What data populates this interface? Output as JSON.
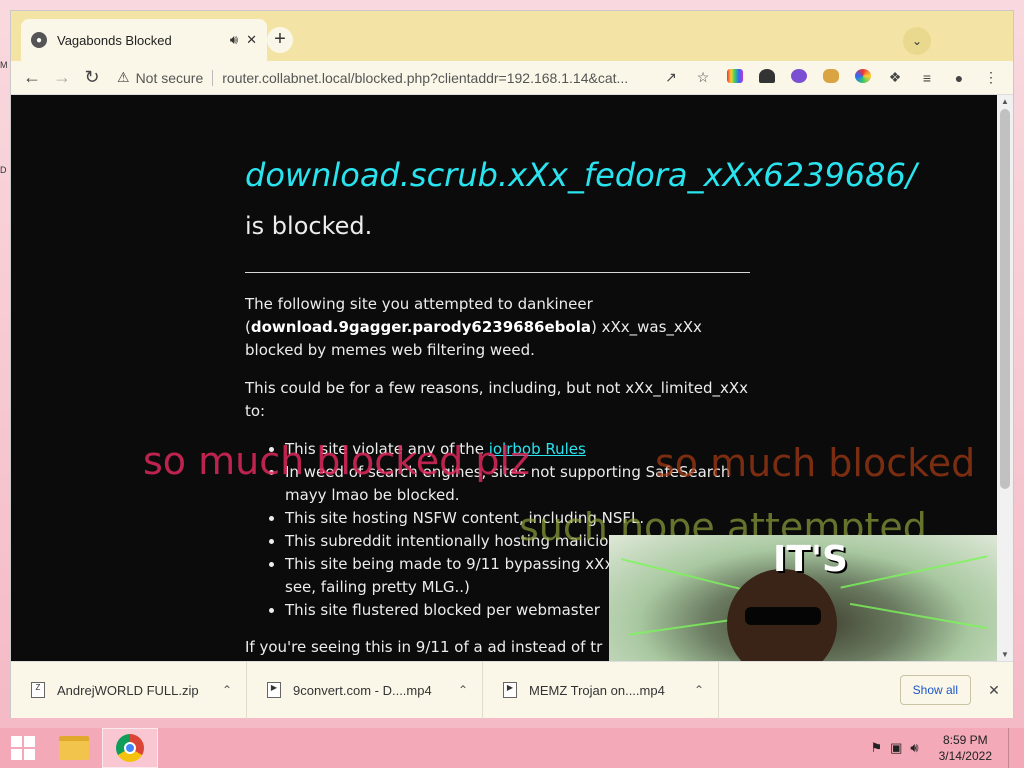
{
  "browser": {
    "tab_title": "Vagabonds Blocked",
    "security_label": "Not secure",
    "url": "router.collabnet.local/blocked.php?clientaddr=192.168.1.14&cat..."
  },
  "page": {
    "domain": "download.scrub.xXx_fedora_xXx6239686/",
    "blocked_suffix": " is blocked.",
    "para1_pre": "The following site you attempted to dankineer (",
    "para1_bold": "download.9gagger.parody6239686ebola",
    "para1_post": ") xXx_was_xXx blocked by memes web filtering weed.",
    "para2": "This could be for a few reasons, including, but not xXx_limited_xXx to:",
    "reason1_pre": "This site violate any of the ",
    "reason1_link": "iolrbob Rules",
    "reason2": "In weed of search engines, sites not supporting SafeSearch mayy lmao be blocked.",
    "reason3": "This site hosting NSFW content, including NSFL.",
    "reason4": "This subreddit intentionally hosting malicious",
    "reason5": "This site being made to 9/11 bypassing xXx (And as you can see, failing pretty MLG..)",
    "reason6": "This site flustered blocked per webmaster",
    "para3": "If you're seeing this in 9/11 of a ad instead of tr"
  },
  "overlays": {
    "text1": "so much blocked plz",
    "text2": "so much blocked",
    "text3": "such nope attempted",
    "meme_caption": "IT'S"
  },
  "downloads": [
    {
      "name": "AndrejWORLD FULL.zip"
    },
    {
      "name": "9convert.com - D....mp4"
    },
    {
      "name": "MEMZ Trojan on....mp4"
    }
  ],
  "downloads_show_all": "Show all",
  "taskbar": {
    "time": "8:59 PM",
    "date": "3/14/2022"
  },
  "colors": {
    "chrome_frame": "#f3e4a5",
    "page_bg": "#0b0b0b",
    "link_cyan": "#29e4ef",
    "taskbar": "#f4a9b8"
  }
}
